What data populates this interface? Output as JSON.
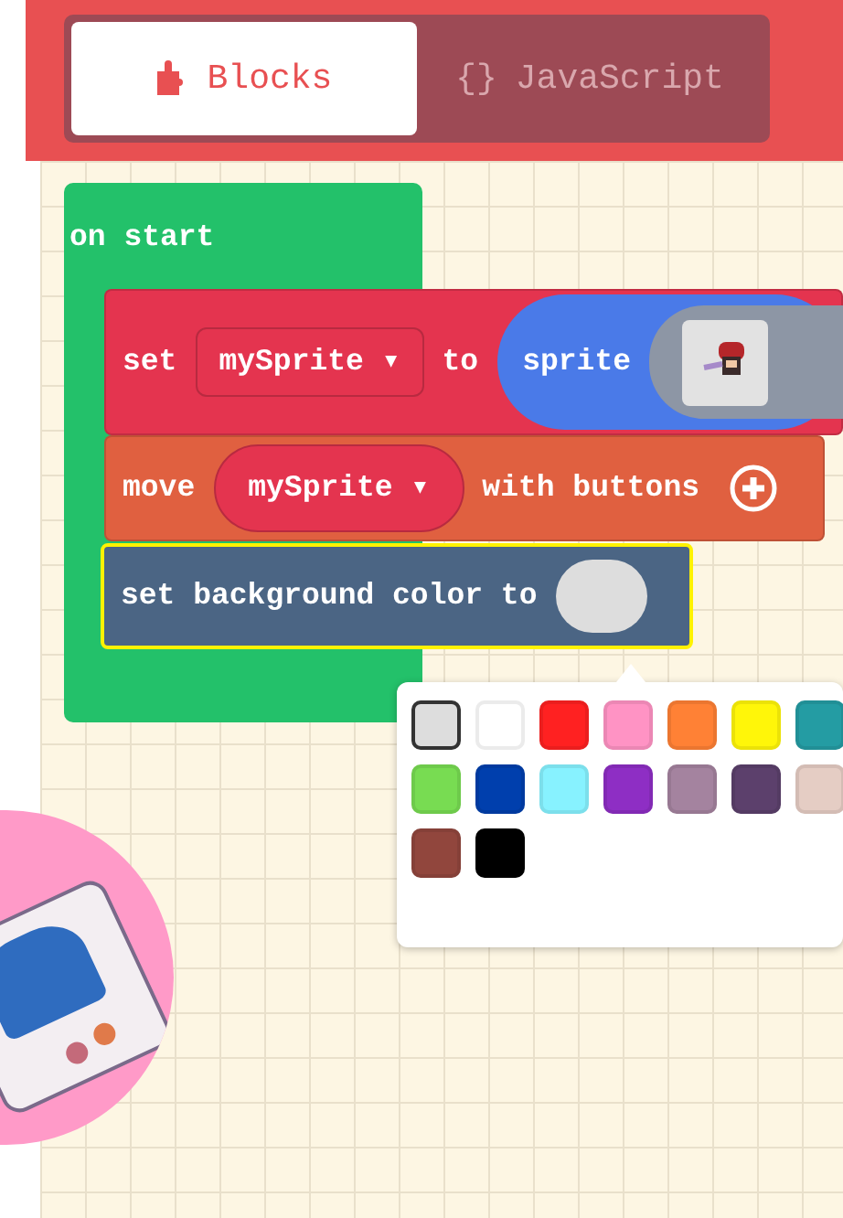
{
  "tabs": [
    {
      "kind": "blocks",
      "label": "Blocks",
      "selected": true
    },
    {
      "kind": "code",
      "icon": "{}",
      "label": "JavaScript",
      "selected": false
    }
  ],
  "on_start": {
    "label": "on start"
  },
  "statements": [
    {
      "kind": "set_sprite",
      "words": [
        "set",
        "to"
      ],
      "variable": "mySprite ▾",
      "reporter": "sprite",
      "highlighted": false
    },
    {
      "kind": "move",
      "words": [
        "move",
        "with buttons"
      ],
      "variable": "mySprite ▾",
      "highlighted": false
    },
    {
      "kind": "background",
      "words": [
        "set background color to"
      ],
      "highlighted": true
    }
  ],
  "palette": [
    {
      "color": "#dddddd",
      "selected": true
    },
    {
      "color": "#ffffff",
      "selected": false
    },
    {
      "color": "#ff2121",
      "selected": false
    },
    {
      "color": "#ff93c4",
      "selected": false
    },
    {
      "color": "#ff8135",
      "selected": false
    },
    {
      "color": "#fff609",
      "selected": false
    },
    {
      "color": "#249ca3",
      "selected": false
    },
    {
      "color": "#78dc52",
      "selected": false
    },
    {
      "color": "#003fad",
      "selected": false
    },
    {
      "color": "#87f2ff",
      "selected": false
    },
    {
      "color": "#8e2ec4",
      "selected": false
    },
    {
      "color": "#a4839f",
      "selected": false
    },
    {
      "color": "#5c406c",
      "selected": false
    },
    {
      "color": "#e5cdc4",
      "selected": false
    },
    {
      "color": "#91463d",
      "selected": false
    },
    {
      "color": "#000000",
      "selected": false
    }
  ]
}
